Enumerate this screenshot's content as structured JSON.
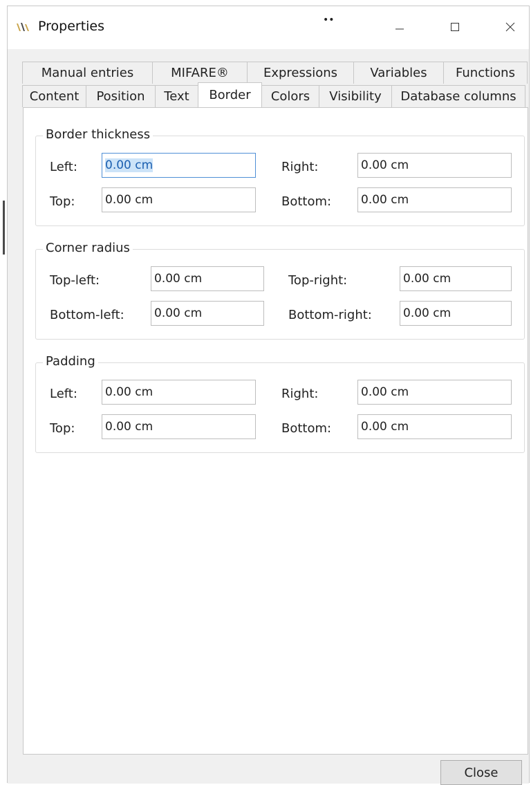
{
  "window": {
    "title": "Properties",
    "title_extra": "••",
    "controls": {
      "minimize_icon": "minimize-icon",
      "maximize_icon": "maximize-icon",
      "close_icon": "close-icon"
    },
    "app_icon": "properties-app-icon"
  },
  "tabs": {
    "back_row": [
      {
        "label": "Manual entries"
      },
      {
        "label": "MIFARE®"
      },
      {
        "label": "Expressions"
      },
      {
        "label": "Variables"
      },
      {
        "label": "Functions"
      }
    ],
    "front_row": [
      {
        "label": "Content"
      },
      {
        "label": "Position"
      },
      {
        "label": "Text"
      },
      {
        "label": "Border",
        "active": true
      },
      {
        "label": "Colors"
      },
      {
        "label": "Visibility"
      },
      {
        "label": "Database columns"
      }
    ]
  },
  "border_thickness": {
    "title": "Border thickness",
    "left_label": "Left:",
    "left_value": "0.00 cm",
    "right_label": "Right:",
    "right_value": "0.00 cm",
    "top_label": "Top:",
    "top_value": "0.00 cm",
    "bottom_label": "Bottom:",
    "bottom_value": "0.00 cm"
  },
  "corner_radius": {
    "title": "Corner radius",
    "top_left_label": "Top-left:",
    "top_left_value": "0.00 cm",
    "top_right_label": "Top-right:",
    "top_right_value": "0.00 cm",
    "bottom_left_label": "Bottom-left:",
    "bottom_left_value": "0.00 cm",
    "bottom_right_label": "Bottom-right:",
    "bottom_right_value": "0.00 cm"
  },
  "padding": {
    "title": "Padding",
    "left_label": "Left:",
    "left_value": "0.00 cm",
    "right_label": "Right:",
    "right_value": "0.00 cm",
    "top_label": "Top:",
    "top_value": "0.00 cm",
    "bottom_label": "Bottom:",
    "bottom_value": "0.00 cm"
  },
  "footer": {
    "close_label": "Close"
  },
  "colors": {
    "selection_bg": "#cce3f8",
    "focus_border": "#4f8fd6"
  }
}
